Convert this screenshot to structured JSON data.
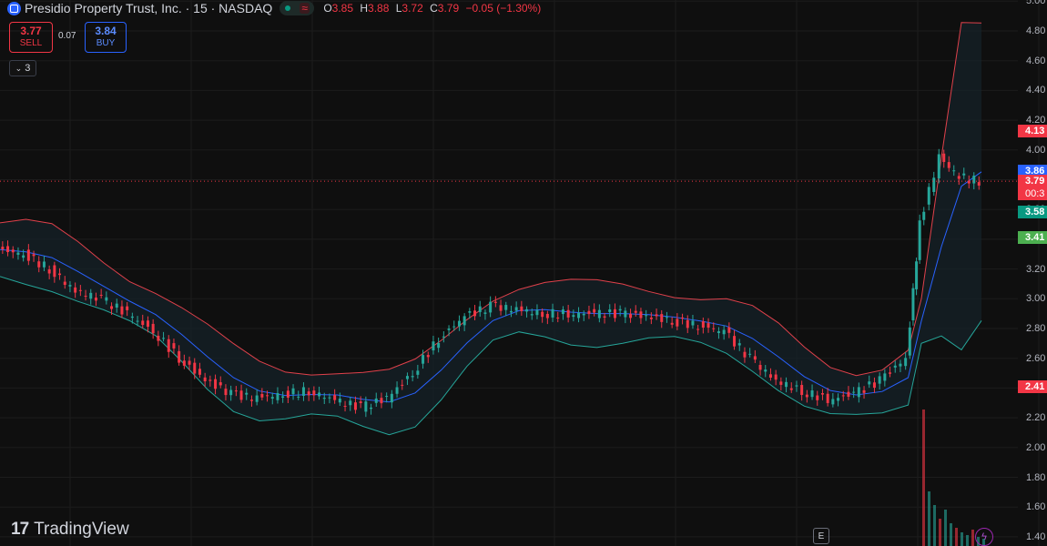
{
  "header": {
    "title": "Presidio Property Trust, Inc. · 15 · NASDAQ",
    "ohlc": [
      {
        "k": "O",
        "v": "3.85"
      },
      {
        "k": "H",
        "v": "3.88"
      },
      {
        "k": "L",
        "v": "3.72"
      },
      {
        "k": "C",
        "v": "3.79"
      }
    ],
    "change": "−0.05 (−1.30%)",
    "status_icon": "live-dot-icon",
    "wave_icon": "wave-icon"
  },
  "trade": {
    "sell_price": "3.77",
    "sell_label": "SELL",
    "spread": "0.07",
    "buy_price": "3.84",
    "buy_label": "BUY"
  },
  "indicators": {
    "count": "3"
  },
  "brand": {
    "name": "TradingView",
    "logo": "tv-logo-icon"
  },
  "buttons": {
    "e_label": "E",
    "bolt_icon": "lightning-icon"
  },
  "price_axis": {
    "ticks": [
      "5.00",
      "4.80",
      "4.60",
      "4.40",
      "4.20",
      "4.00",
      "3.80",
      "3.60",
      "3.40",
      "3.20",
      "3.00",
      "2.80",
      "2.60",
      "2.40",
      "2.20",
      "2.00",
      "1.80",
      "1.60",
      "1.40"
    ],
    "tags": [
      {
        "value": "4.13",
        "color": "#f23645"
      },
      {
        "value": "3.86",
        "color": "#2962ff"
      },
      {
        "value": "3.79",
        "color": "#f23645",
        "countdown": "00:3"
      },
      {
        "value": "3.58",
        "color": "#089981"
      },
      {
        "value": "3.41",
        "color": "#4caf50"
      },
      {
        "value": "2.41",
        "color": "#f23645"
      },
      {
        "value": "13.6",
        "color": "#f23645"
      }
    ]
  },
  "colors": {
    "up": "#26a69a",
    "down": "#f23645",
    "basis": "#2962ff",
    "upper_band": "#e0414b",
    "lower_band": "#26a69a",
    "background": "#0f0f0f"
  },
  "chart_data": {
    "type": "line",
    "title": "",
    "ylim": [
      1.4,
      5.0
    ],
    "series": [
      {
        "name": "",
        "values": [
          3.33,
          3.3,
          3.2,
          3.05,
          3.0,
          2.9,
          2.78,
          2.6,
          2.45,
          2.36,
          2.33,
          2.36,
          2.38,
          2.32,
          2.27,
          2.33,
          2.5,
          2.73,
          2.88,
          2.95,
          2.93,
          2.9,
          2.9,
          2.9,
          2.9,
          2.88,
          2.85,
          2.82,
          2.78,
          2.6,
          2.45,
          2.38,
          2.32,
          2.36,
          2.45,
          2.6,
          3.5,
          3.95,
          3.82,
          3.79
        ]
      }
    ]
  }
}
